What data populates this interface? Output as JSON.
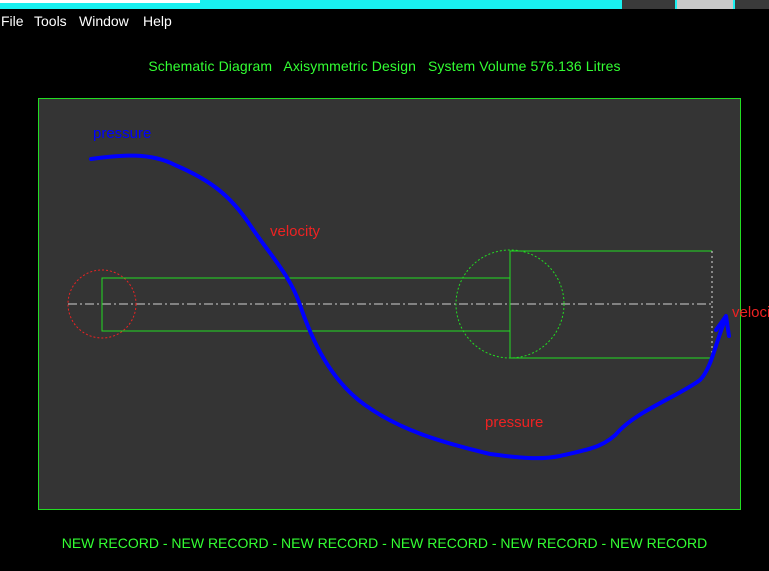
{
  "menu": {
    "file": "File",
    "tools": "Tools",
    "window": "Window",
    "help": "Help"
  },
  "header": {
    "text": "Schematic Diagram   Axisymmetric Design   System Volume 576.136 Litres"
  },
  "labels": {
    "pressure_top": "pressure",
    "velocity_mid": "velocity",
    "velocity_right": "velocity",
    "pressure_bottom": "pressure"
  },
  "footer": {
    "text": "NEW RECORD - NEW RECORD - NEW RECORD - NEW RECORD - NEW RECORD - NEW RECORD"
  },
  "colors": {
    "accent_green": "#33ff33",
    "panel_bg": "#343434",
    "stroke_blue": "#0000ff",
    "label_red": "#ee2222",
    "titlebar": "#19f0f0"
  }
}
